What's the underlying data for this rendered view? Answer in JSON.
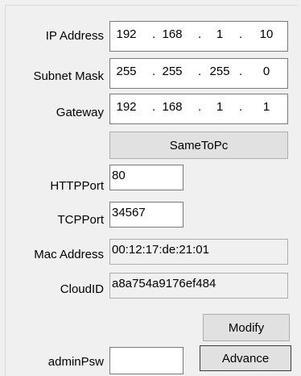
{
  "labels": {
    "ip": "IP Address",
    "subnet": "Subnet Mask",
    "gateway": "Gateway",
    "http_port": "HTTPPort",
    "tcp_port": "TCPPort",
    "mac": "Mac Address",
    "cloud_id": "CloudID",
    "admin_psw": "adminPsw"
  },
  "ip_address": [
    "192",
    "168",
    "1",
    "10"
  ],
  "subnet_mask": [
    "255",
    "255",
    "255",
    "0"
  ],
  "gateway": [
    "192",
    "168",
    "1",
    "1"
  ],
  "buttons": {
    "same_to_pc": "SameToPc",
    "modify": "Modify",
    "advance": "Advance"
  },
  "http_port": "80",
  "tcp_port": "34567",
  "mac_address": "00:12:17:de:21:01",
  "cloud_id": "a8a754a9176ef484",
  "admin_psw": "",
  "ip_separator": "."
}
